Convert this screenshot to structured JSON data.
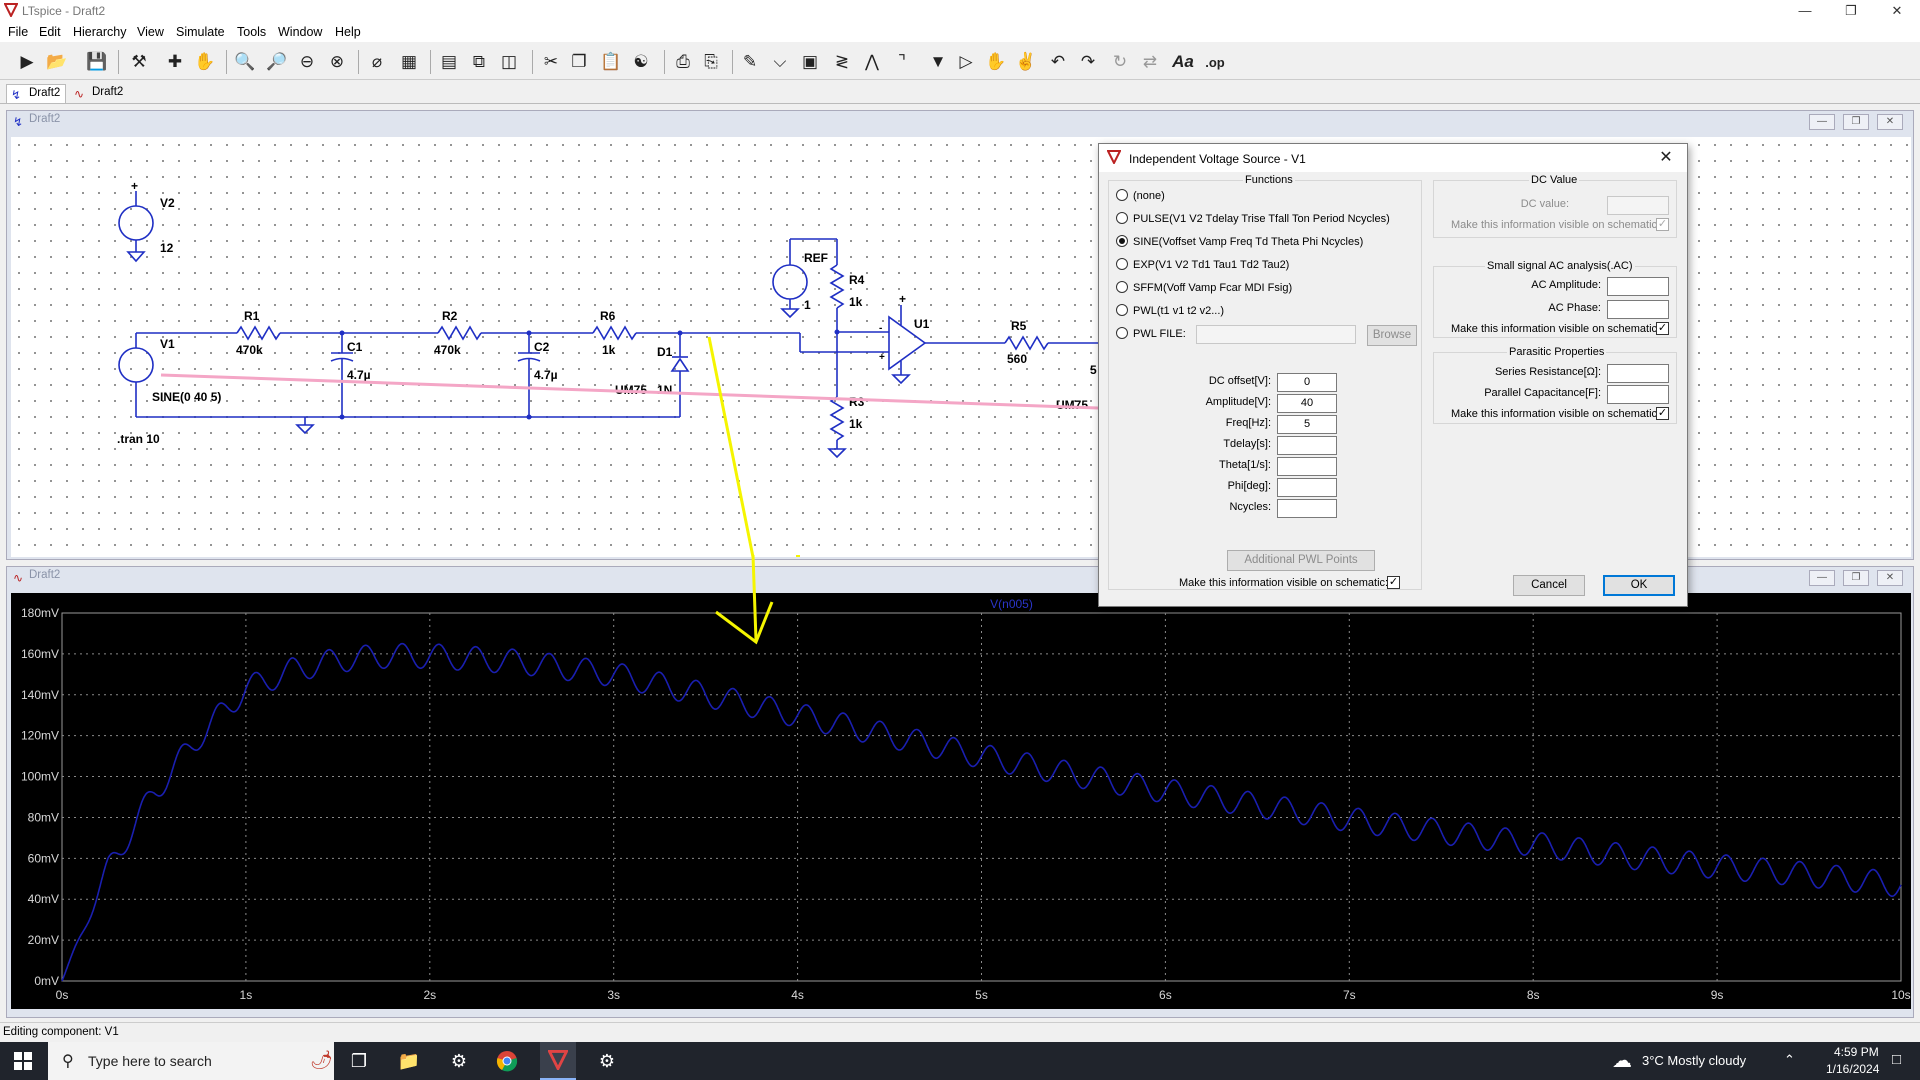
{
  "window": {
    "title": "LTspice - Draft2"
  },
  "menu": [
    "File",
    "Edit",
    "Hierarchy",
    "View",
    "Simulate",
    "Tools",
    "Window",
    "Help"
  ],
  "toolbar_icons": [
    "run-icon",
    "open-icon",
    "save-icon",
    "control-panel-icon",
    "halt-icon",
    "pan-icon",
    "zoom-in-icon",
    "zoom-back-icon",
    "zoom-out-icon",
    "zoom-fit-icon",
    "autorange-icon",
    "mark-range-icon",
    "tile-horizontal-icon",
    "cascade-icon",
    "tile-vertical-icon",
    "cut-icon",
    "copy-icon",
    "paste-icon",
    "find-icon",
    "print-icon",
    "print-preview-icon",
    "draw-wire-icon",
    "ground-icon",
    "label-net-icon",
    "resistor-icon",
    "capacitor-icon",
    "inductor-icon",
    "diode-icon",
    "component-icon",
    "move-icon",
    "drag-icon",
    "undo-icon",
    "redo-icon",
    "rotate-icon",
    "mirror-icon",
    "text-icon",
    "spice-directive-icon"
  ],
  "tabs": [
    {
      "label": "Draft2",
      "icon": "schematic-icon"
    },
    {
      "label": "Draft2",
      "icon": "waveform-icon"
    }
  ],
  "schematic_window": {
    "title": "Draft2"
  },
  "waveform_window": {
    "title": "Draft2"
  },
  "schematic": {
    "components": {
      "V2": "V2",
      "V2_value": "12",
      "V1": "V1",
      "V1_value": "SINE(0 40 5)",
      "REF": "REF",
      "REF_value": "1",
      "R1": "R1",
      "R1_value": "470k",
      "R2": "R2",
      "R2_value": "470k",
      "R6": "R6",
      "R6_value": "1k",
      "R4": "R4",
      "R4_value": "1k",
      "R3": "R3",
      "R3_value": "1k",
      "R5": "R5",
      "R5_value": "560",
      "C1": "C1",
      "C1_value": "4.7µ",
      "C2": "C2",
      "C2_value": "4.7µ",
      "D1": "D1",
      "D1_value": "1N",
      "D1_model": "UM75",
      "U1": "U1",
      "R5_partial_value": "5",
      "partial_model_right": "UM75"
    },
    "directive": ".tran 10"
  },
  "dialog": {
    "title": "Independent Voltage Source - V1",
    "functions_label": "Functions",
    "functions": [
      {
        "label": "(none)",
        "selected": false
      },
      {
        "label": "PULSE(V1 V2 Tdelay Trise Tfall Ton Period Ncycles)",
        "selected": false
      },
      {
        "label": "SINE(Voffset Vamp Freq Td Theta Phi Ncycles)",
        "selected": true
      },
      {
        "label": "EXP(V1 V2 Td1 Tau1 Td2 Tau2)",
        "selected": false
      },
      {
        "label": "SFFM(Voff Vamp Fcar MDI Fsig)",
        "selected": false
      },
      {
        "label": "PWL(t1 v1 t2 v2...)",
        "selected": false
      },
      {
        "label": "PWL FILE:",
        "selected": false
      }
    ],
    "browse": "Browse",
    "params": [
      {
        "label": "DC offset[V]:",
        "value": "0"
      },
      {
        "label": "Amplitude[V]:",
        "value": "40"
      },
      {
        "label": "Freq[Hz]:",
        "value": "5"
      },
      {
        "label": "Tdelay[s]:",
        "value": ""
      },
      {
        "label": "Theta[1/s]:",
        "value": ""
      },
      {
        "label": "Phi[deg]:",
        "value": ""
      },
      {
        "label": "Ncycles:",
        "value": ""
      }
    ],
    "additional_pwl": "Additional PWL Points",
    "visible_on_schematic": "Make this information visible on schematic:",
    "dc_value": {
      "group": "DC Value",
      "label": "DC value:",
      "value": "",
      "visible": "Make this information visible on schematic:"
    },
    "ac": {
      "group": "Small signal AC analysis(.AC)",
      "amplitude_label": "AC Amplitude:",
      "amplitude_value": "",
      "phase_label": "AC Phase:",
      "phase_value": "",
      "visible": "Make this information visible on schematic:"
    },
    "parasitic": {
      "group": "Parasitic Properties",
      "series_label": "Series Resistance[Ω]:",
      "series_value": "",
      "parallel_label": "Parallel Capacitance[F]:",
      "parallel_value": "",
      "visible": "Make this information visible on schematic:"
    },
    "cancel": "Cancel",
    "ok": "OK"
  },
  "chart_data": {
    "type": "line",
    "title": "",
    "series": [
      {
        "name": "V(n005)",
        "color": "#1a1fb0"
      }
    ],
    "envelope": {
      "x": [
        0,
        0.25,
        0.5,
        0.75,
        1.0,
        1.25,
        1.5,
        1.75,
        2.0,
        2.5,
        3.0,
        3.5,
        4.0,
        4.5,
        5.0,
        5.5,
        6.0,
        6.5,
        7.0,
        7.5,
        8.0,
        8.5,
        9.0,
        9.5,
        10.0
      ],
      "y": [
        0,
        55,
        92,
        120,
        143,
        152,
        157,
        159,
        159,
        156,
        150,
        140,
        130,
        120,
        110,
        101,
        93,
        86,
        79,
        73,
        67,
        61,
        56,
        52,
        47
      ]
    },
    "ripple_hz": 5,
    "ripple_amplitude_mV": 6,
    "xlim": [
      0,
      10
    ],
    "ylim": [
      0,
      180
    ],
    "x_ticks": [
      "0s",
      "1s",
      "2s",
      "3s",
      "4s",
      "5s",
      "6s",
      "7s",
      "8s",
      "9s",
      "10s"
    ],
    "y_ticks": [
      "0mV",
      "20mV",
      "40mV",
      "60mV",
      "80mV",
      "100mV",
      "120mV",
      "140mV",
      "160mV",
      "180mV"
    ],
    "grid": true,
    "background": "#000000"
  },
  "status": {
    "text": "Editing component: V1"
  },
  "taskbar": {
    "search_placeholder": "Type here to search",
    "weather": "3°C  Mostly cloudy",
    "time": "4:59 PM",
    "date": "1/16/2024"
  },
  "colors": {
    "wire": "#1f2fc4",
    "annotation_pink": "#f4a6c6",
    "annotation_yellow": "#f5f500",
    "trace": "#1a1fb0"
  }
}
